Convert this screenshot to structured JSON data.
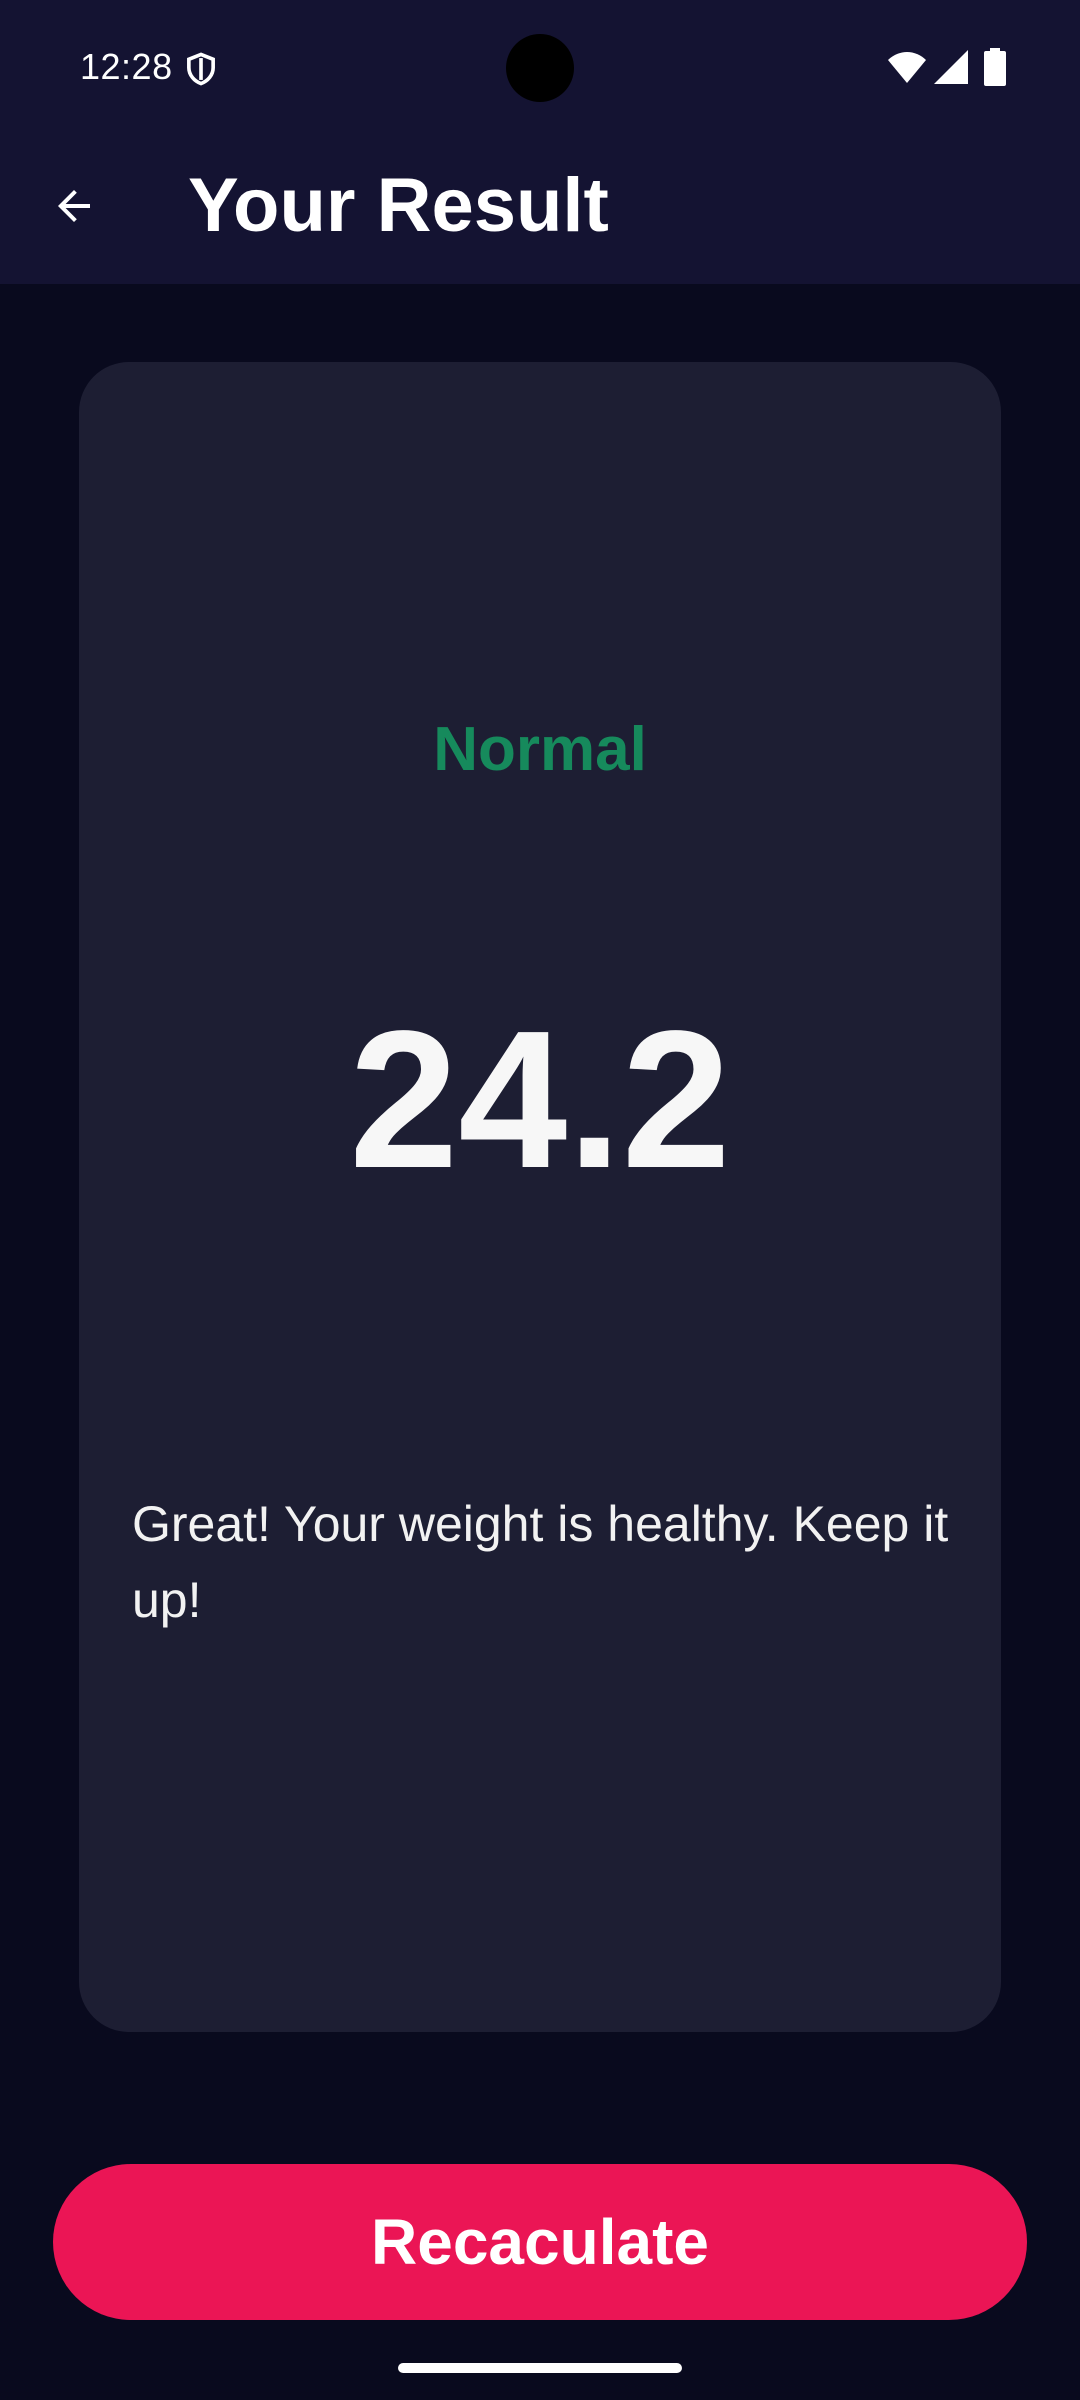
{
  "status_bar": {
    "time": "12:28",
    "icons": [
      "shield-icon",
      "wifi-icon",
      "signal-icon",
      "battery-icon"
    ]
  },
  "app_bar": {
    "back_icon": "arrow-back-icon",
    "title": "Your Result"
  },
  "result": {
    "category": "Normal",
    "value": "24.2",
    "message": "Great! Your weight is healthy. Keep it up!"
  },
  "actions": {
    "recalculate_label": "Recaculate"
  },
  "colors": {
    "background": "#090a1e",
    "app_bar": "#141332",
    "card": "#1d1e33",
    "category_green": "#168a5c",
    "accent_pink": "#eb1555"
  }
}
